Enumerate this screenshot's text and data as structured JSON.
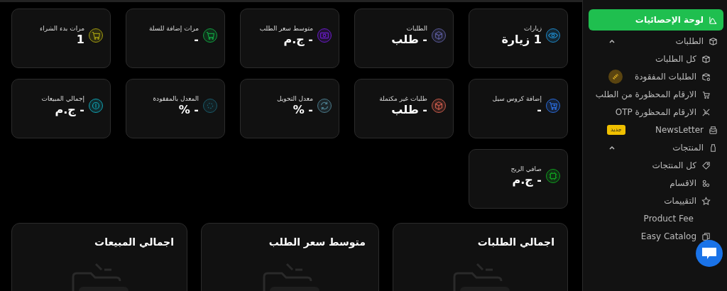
{
  "stat_cards": [
    {
      "title": "زيارات",
      "value": "1 زيارة",
      "color": "#1e88c8"
    },
    {
      "title": "الطلبات",
      "value": "- طلب",
      "color": "#5a5a9a"
    },
    {
      "title": "متوسط سعر الطلب",
      "value": "- ج.م",
      "color": "#6a1bc8"
    },
    {
      "title": "مرات إضافة للسلة",
      "value": "-",
      "color": "#10a040"
    },
    {
      "title": "مرات بدء الشراء",
      "value": "1",
      "color": "#a09a10"
    },
    {
      "title": "إضافة كروس سيل",
      "value": "-",
      "color": "#2a6ad8"
    },
    {
      "title": "طلبات غير مكتملة",
      "value": "- طلب",
      "color": "#c85a4a"
    },
    {
      "title": "معدل التحويل",
      "value": "- %",
      "color": "#4a7a8a"
    },
    {
      "title": "المعدل بالمفقودة",
      "value": "- %",
      "color": "#1a5a6a"
    },
    {
      "title": "إجمالي المبيعات",
      "value": "- ج.م",
      "color": "#10a0b0"
    },
    {
      "title": "صافي الربح",
      "value": "- ج.م",
      "color": "#10a020"
    }
  ],
  "chart_panels": [
    {
      "title": "اجمالي الطلبات"
    },
    {
      "title": "متوسط سعر الطلب"
    },
    {
      "title": "اجمالي المبيعات"
    }
  ],
  "sidebar": {
    "items": [
      {
        "kind": "link",
        "label": "لوحة الإحصائيات",
        "selected": true
      },
      {
        "kind": "section",
        "label": "الطلبات",
        "expanded": true,
        "children": [
          {
            "kind": "link",
            "label": "كل الطلبات",
            "selected": false
          },
          {
            "kind": "link",
            "label": "الطلبات المفقودة",
            "selected": false,
            "indicator": true
          },
          {
            "kind": "link",
            "label": "الارقام المحظورة من الطلب",
            "selected": false
          },
          {
            "kind": "link",
            "label": "الارقام المحظورة OTP",
            "selected": false
          }
        ]
      },
      {
        "kind": "link",
        "label": "NewsLetter",
        "selected": false,
        "badge": "جديد"
      },
      {
        "kind": "section",
        "label": "المنتجات",
        "expanded": true,
        "children": [
          {
            "kind": "link",
            "label": "كل المنتجات",
            "selected": false
          },
          {
            "kind": "link",
            "label": "الاقسام",
            "selected": false
          },
          {
            "kind": "link",
            "label": "التقييمات",
            "selected": false
          },
          {
            "kind": "link",
            "label": "Product Fee",
            "selected": false
          },
          {
            "kind": "link",
            "label": "Easy Catalog",
            "selected": false
          }
        ]
      }
    ]
  }
}
